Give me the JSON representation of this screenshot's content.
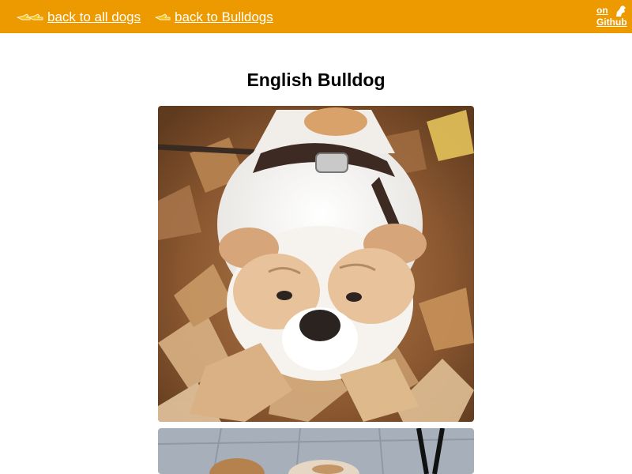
{
  "nav": {
    "back_all_label": "back to all dogs",
    "back_breed_label": "back to Bulldogs",
    "hand_icon": "pointing-hand-icon"
  },
  "github": {
    "on_label": "on",
    "name_label": "Github",
    "icon": "dog-icon"
  },
  "page": {
    "title": "English Bulldog"
  },
  "photos": [
    {
      "description_icon": "bulldog-in-leaves-photo"
    },
    {
      "description_icon": "bulldog-on-pavement-photo"
    }
  ],
  "colors": {
    "header_bg": "#ec9a00",
    "header_text": "#ffffff",
    "hand_fill": "#f7c21c"
  }
}
